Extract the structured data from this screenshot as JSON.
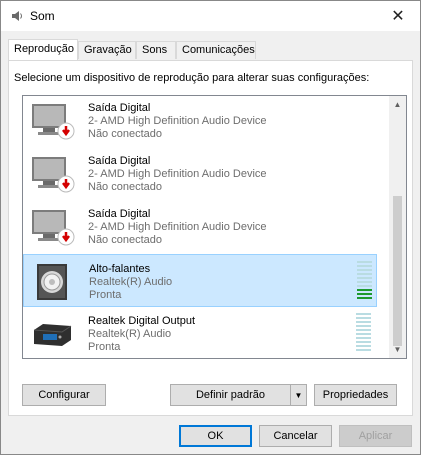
{
  "window": {
    "title": "Som",
    "close_glyph": "✕",
    "icon": "speaker-app-icon"
  },
  "tabs": [
    {
      "label": "Reprodução",
      "active": true
    },
    {
      "label": "Gravação",
      "active": false
    },
    {
      "label": "Sons",
      "active": false
    },
    {
      "label": "Comunicações",
      "active": false
    }
  ],
  "instruction": "Selecione um dispositivo de reprodução para alterar suas configurações:",
  "devices": [
    {
      "name": "Saída Digital",
      "driver": "2- AMD High Definition Audio Device",
      "status": "Não conectado",
      "icon": "monitor-disconnected-icon",
      "selected": false
    },
    {
      "name": "Saída Digital",
      "driver": "2- AMD High Definition Audio Device",
      "status": "Não conectado",
      "icon": "monitor-disconnected-icon",
      "selected": false
    },
    {
      "name": "Saída Digital",
      "driver": "2- AMD High Definition Audio Device",
      "status": "Não conectado",
      "icon": "monitor-disconnected-icon",
      "selected": false
    },
    {
      "name": "Alto-falantes",
      "driver": "Realtek(R) Audio",
      "status": "Pronta",
      "icon": "speaker-icon",
      "selected": true,
      "level": 0.3
    },
    {
      "name": "Realtek Digital Output",
      "driver": "Realtek(R) Audio",
      "status": "Pronta",
      "icon": "digital-output-icon",
      "selected": false,
      "level": 0
    }
  ],
  "buttons": {
    "configure": "Configurar",
    "set_default": "Definir padrão",
    "properties": "Propriedades",
    "ok": "OK",
    "cancel": "Cancelar",
    "apply": "Aplicar"
  },
  "colors": {
    "selection_bg": "#cce8ff",
    "selection_border": "#99d1ff",
    "meter_active": "#1c9a2e",
    "meter_inactive": "#b9dce2",
    "disconnected_badge": "#d40000"
  }
}
